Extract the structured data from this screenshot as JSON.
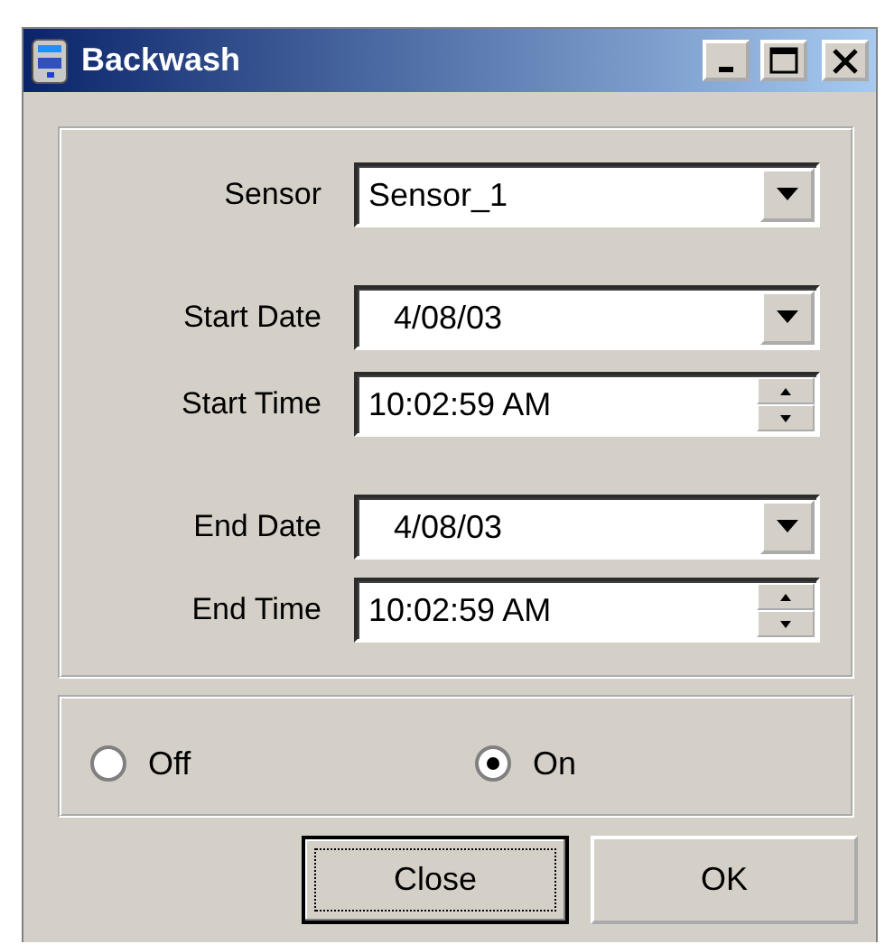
{
  "window": {
    "title": "Backwash"
  },
  "field_groups": [
    [
      {
        "label": "Sensor",
        "value": "Sensor_1",
        "kind": "combo"
      }
    ],
    [
      {
        "label": "Start Date",
        "value": "4/08/03",
        "kind": "date"
      },
      {
        "label": "Start Time",
        "value": "10:02:59 AM",
        "kind": "time"
      }
    ],
    [
      {
        "label": "End Date",
        "value": "4/08/03",
        "kind": "date"
      },
      {
        "label": "End Time",
        "value": "10:02:59 AM",
        "kind": "time"
      }
    ]
  ],
  "radios": [
    {
      "label": "Off",
      "selected": false
    },
    {
      "label": "On",
      "selected": true
    }
  ],
  "buttons": [
    {
      "label": "Close",
      "focused": true
    },
    {
      "label": "OK",
      "focused": false
    }
  ]
}
